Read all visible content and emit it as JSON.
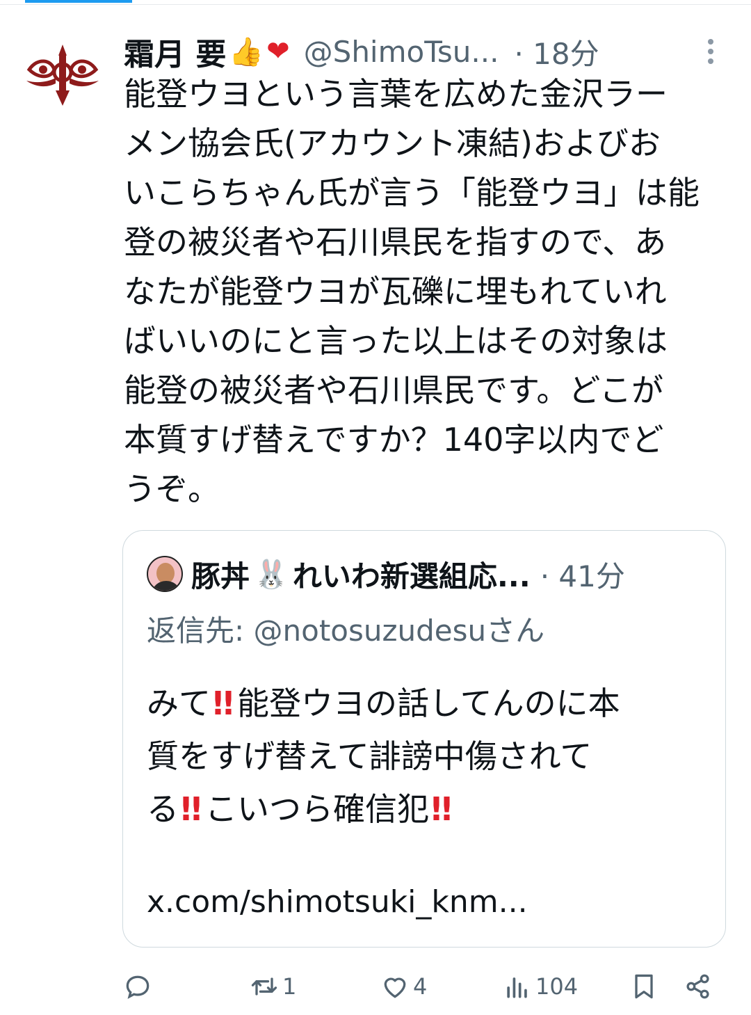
{
  "tweet": {
    "author_name": "霜月 要",
    "author_emoji": [
      "👍",
      "❤"
    ],
    "handle": "@ShimoTsu...",
    "time": "· 18分",
    "text_lines": [
      "能登ウヨという言葉を広めた金沢ラー",
      "メン協会氏(アカウント凍結)およびお",
      "いこらちゃん氏が言う「能登ウヨ」は能",
      "登の被災者や石川県民を指すので、あ",
      "なたが能登ウヨが瓦礫に埋もれていれ",
      "ばいいのにと言った以上はその対象は",
      "能登の被災者や石川県民です。どこが",
      "本質すげ替えですか？140字以内でど",
      "うぞ。"
    ]
  },
  "quote": {
    "author_name": "豚丼",
    "author_emoji": "🐰",
    "author_name_rest": "れいわ新選組応...",
    "time": "· 41分",
    "reply_to": "返信先: @notosuzudesuさん",
    "text": {
      "l1_a": "みて",
      "l1_b": "能登ウヨの話してんのに本",
      "l2": "質をすげ替えて誹謗中傷されて",
      "l3_a": "る",
      "l3_b": "こいつら確信犯",
      "bang": "!!"
    },
    "link": "x.com/shimotsuki_knm..."
  },
  "actions": {
    "reply": {
      "icon": "reply-icon",
      "count": ""
    },
    "retweet": {
      "icon": "retweet-icon",
      "count": "1"
    },
    "like": {
      "icon": "heart-icon",
      "count": "4"
    },
    "views": {
      "icon": "views-icon",
      "count": "104"
    },
    "bookmark": {
      "icon": "bookmark-icon",
      "count": ""
    },
    "share": {
      "icon": "share-icon",
      "count": ""
    }
  },
  "colors": {
    "secondary_text": "#536471",
    "accent": "#1d9bf0",
    "border": "#cfd9de",
    "exclaim": "#e0202a"
  }
}
